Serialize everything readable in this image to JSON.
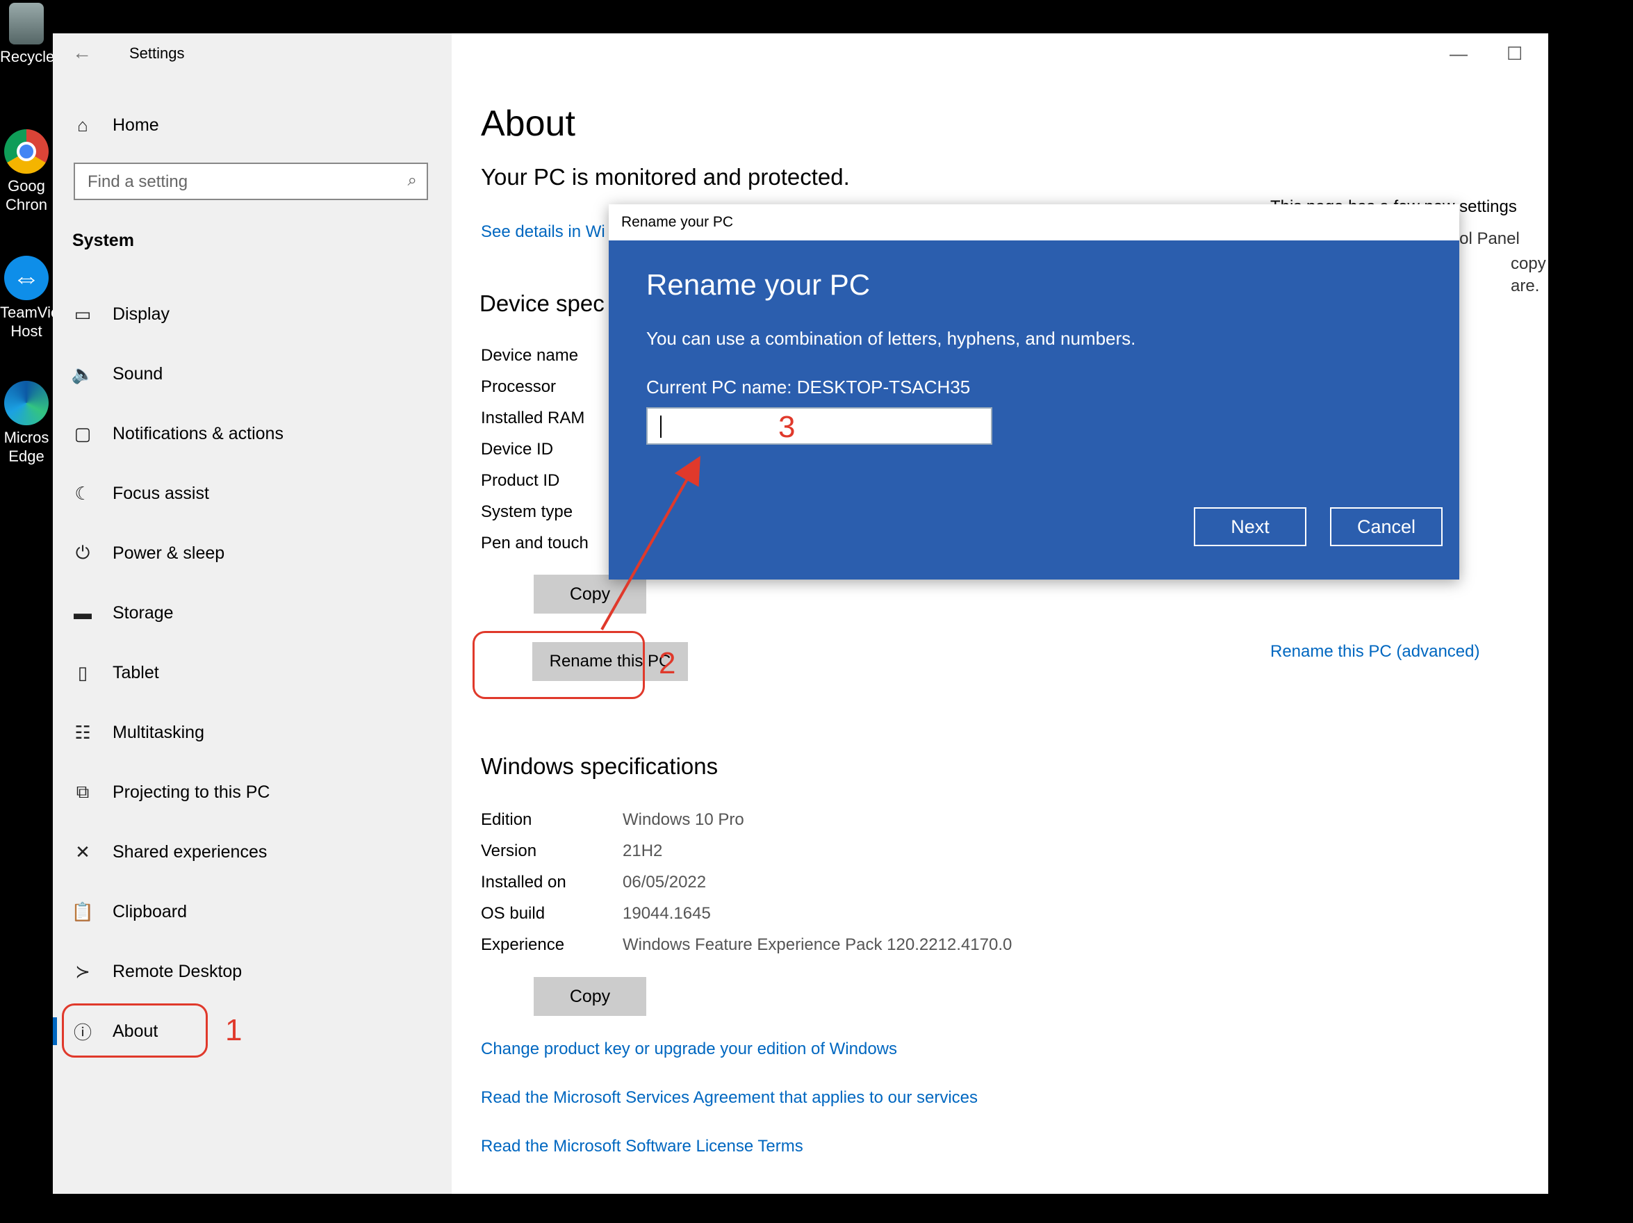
{
  "desktop": {
    "icons": [
      {
        "label1": "Recycle",
        "label2": ""
      },
      {
        "label1": "Goog",
        "label2": "Chron"
      },
      {
        "label1": "TeamVie",
        "label2": "Host"
      },
      {
        "label1": "Micros",
        "label2": "Edge"
      }
    ]
  },
  "window": {
    "title": "Settings",
    "back": "←",
    "minimize": "—",
    "maximize": "☐",
    "close": "✕"
  },
  "sidebar": {
    "home": "Home",
    "search_placeholder": "Find a setting",
    "section": "System",
    "items": [
      {
        "label": "Display",
        "icon": "display-icon"
      },
      {
        "label": "Sound",
        "icon": "sound-icon"
      },
      {
        "label": "Notifications & actions",
        "icon": "notifications-icon"
      },
      {
        "label": "Focus assist",
        "icon": "focus-assist-icon"
      },
      {
        "label": "Power & sleep",
        "icon": "power-icon"
      },
      {
        "label": "Storage",
        "icon": "storage-icon"
      },
      {
        "label": "Tablet",
        "icon": "tablet-icon"
      },
      {
        "label": "Multitasking",
        "icon": "multitasking-icon"
      },
      {
        "label": "Projecting to this PC",
        "icon": "projecting-icon"
      },
      {
        "label": "Shared experiences",
        "icon": "shared-icon"
      },
      {
        "label": "Clipboard",
        "icon": "clipboard-icon"
      },
      {
        "label": "Remote Desktop",
        "icon": "remote-desktop-icon"
      },
      {
        "label": "About",
        "icon": "info-icon"
      }
    ]
  },
  "main": {
    "title": "About",
    "protected": "Your PC is monitored and protected.",
    "see_details": "See details in Wi",
    "device_spec_heading": "Device spec",
    "device_specs": [
      "Device name",
      "Processor",
      "Installed RAM",
      "Device ID",
      "Product ID",
      "System type",
      "Pen and touch"
    ],
    "copy_label": "Copy",
    "rename_label": "Rename this PC",
    "windows_spec_heading": "Windows specifications",
    "windows_specs": [
      {
        "label": "Edition",
        "value": "Windows 10 Pro"
      },
      {
        "label": "Version",
        "value": "21H2"
      },
      {
        "label": "Installed on",
        "value": "06/05/2022"
      },
      {
        "label": "OS build",
        "value": "19044.1645"
      },
      {
        "label": "Experience",
        "value": "Windows Feature Experience Pack 120.2212.4170.0"
      }
    ],
    "links": [
      "Change product key or upgrade your edition of Windows",
      "Read the Microsoft Services Agreement that applies to our services",
      "Read the Microsoft Software License Terms"
    ],
    "right_heading": "This page has a few new settings",
    "right_frag1": "Some settings from Control Panel",
    "right_frag2": "copy",
    "right_frag3": "are.",
    "rename_advanced": "Rename this PC (advanced)"
  },
  "dialog": {
    "titlebar": "Rename your PC",
    "heading": "Rename your PC",
    "description": "You can use a combination of letters, hyphens, and numbers.",
    "current_name": "Current PC name: DESKTOP-TSACH35",
    "input_value": "",
    "next": "Next",
    "cancel": "Cancel"
  },
  "annotations": {
    "step1": "1",
    "step2": "2",
    "step3": "3",
    "color": "#e0392b"
  },
  "colors": {
    "accent": "#0067c0",
    "dialog_bg": "#2b5eae",
    "sidebar_bg": "#f0f0f0",
    "button_bg": "#cccccc"
  }
}
